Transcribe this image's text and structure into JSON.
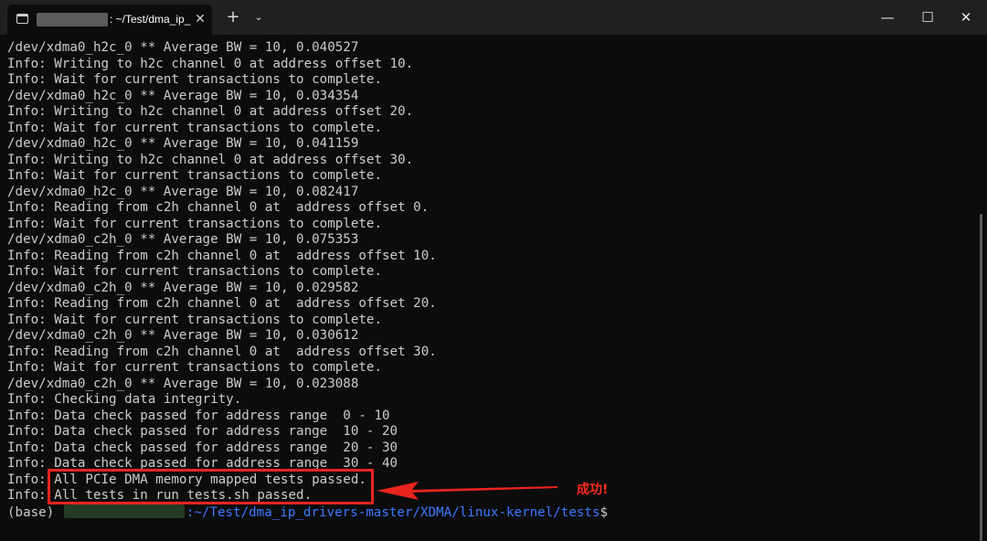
{
  "tab": {
    "title": ": ~/Test/dma_ip_",
    "close_glyph": "✕"
  },
  "titlebar": {
    "new_tab_glyph": "+",
    "dropdown_glyph": "⌄",
    "minimize_glyph": "—",
    "maximize_glyph": "☐",
    "close_glyph": "✕"
  },
  "terminal": {
    "lines": [
      "/dev/xdma0_h2c_0 ** Average BW = 10, 0.040527",
      "Info: Writing to h2c channel 0 at address offset 10.",
      "Info: Wait for current transactions to complete.",
      "/dev/xdma0_h2c_0 ** Average BW = 10, 0.034354",
      "Info: Writing to h2c channel 0 at address offset 20.",
      "Info: Wait for current transactions to complete.",
      "/dev/xdma0_h2c_0 ** Average BW = 10, 0.041159",
      "Info: Writing to h2c channel 0 at address offset 30.",
      "Info: Wait for current transactions to complete.",
      "/dev/xdma0_h2c_0 ** Average BW = 10, 0.082417",
      "Info: Reading from c2h channel 0 at  address offset 0.",
      "Info: Wait for current transactions to complete.",
      "/dev/xdma0_c2h_0 ** Average BW = 10, 0.075353",
      "Info: Reading from c2h channel 0 at  address offset 10.",
      "Info: Wait for current transactions to complete.",
      "/dev/xdma0_c2h_0 ** Average BW = 10, 0.029582",
      "Info: Reading from c2h channel 0 at  address offset 20.",
      "Info: Wait for current transactions to complete.",
      "/dev/xdma0_c2h_0 ** Average BW = 10, 0.030612",
      "Info: Reading from c2h channel 0 at  address offset 30.",
      "Info: Wait for current transactions to complete.",
      "/dev/xdma0_c2h_0 ** Average BW = 10, 0.023088",
      "Info: Checking data integrity.",
      "Info: Data check passed for address range  0 - 10",
      "Info: Data check passed for address range  10 - 20",
      "Info: Data check passed for address range  20 - 30",
      "Info: Data check passed for address range  30 - 40",
      "Info: All PCIe DMA memory mapped tests passed.",
      "Info: All tests in run_tests.sh passed."
    ],
    "prompt": {
      "env": "(base) ",
      "path": ":~/Test/dma_ip_drivers-master/XDMA/linux-kernel/tests",
      "symbol": "$"
    }
  },
  "annotation": {
    "text": "成功!",
    "color": "#ff2a1f"
  }
}
